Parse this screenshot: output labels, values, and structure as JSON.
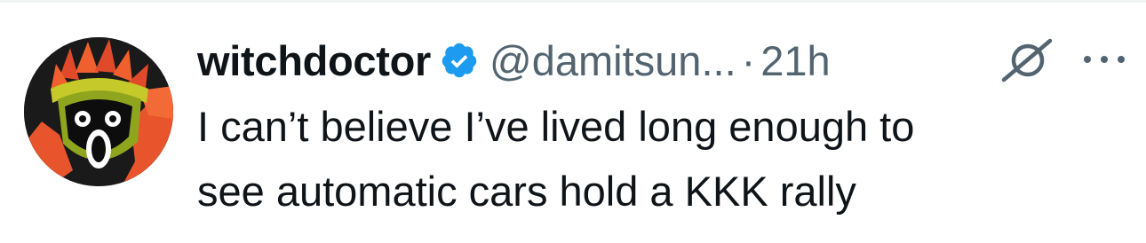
{
  "tweet": {
    "author": {
      "display_name": "witchdoctor",
      "handle": "@damitsun...",
      "verified": true,
      "avatar_icon": "witchdoctor-mask-avatar"
    },
    "separator": "·",
    "timestamp": "21h",
    "actions": {
      "grok_icon": "grok-icon",
      "more_icon": "more-options-icon"
    },
    "text": "I can’t believe I’ve lived long enough to\nsee automatic cars hold a KKK rally"
  },
  "colors": {
    "text_primary": "#0f1419",
    "text_secondary": "#536471",
    "verified_blue": "#1d9bf0",
    "divider": "#eff3f4"
  }
}
